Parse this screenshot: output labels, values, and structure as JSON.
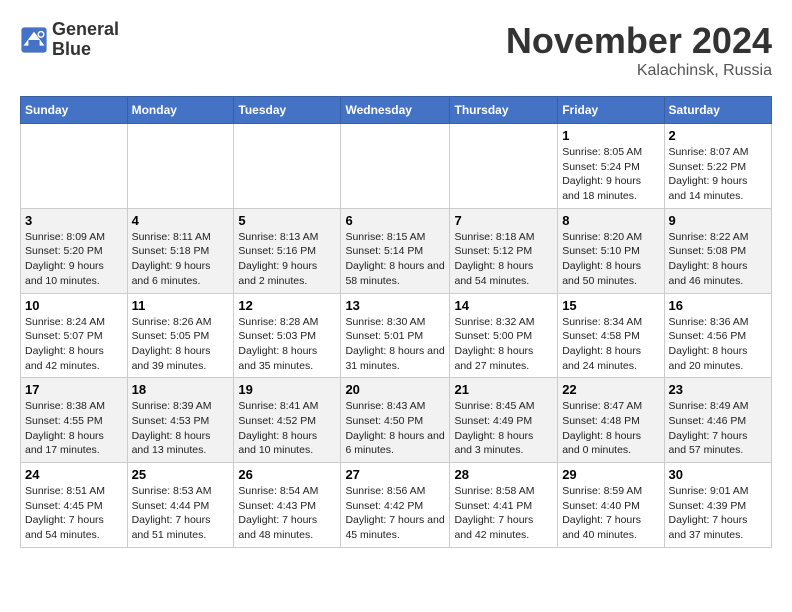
{
  "logo": {
    "line1": "General",
    "line2": "Blue"
  },
  "title": "November 2024",
  "location": "Kalachinsk, Russia",
  "days_of_week": [
    "Sunday",
    "Monday",
    "Tuesday",
    "Wednesday",
    "Thursday",
    "Friday",
    "Saturday"
  ],
  "weeks": [
    [
      {
        "day": "",
        "info": ""
      },
      {
        "day": "",
        "info": ""
      },
      {
        "day": "",
        "info": ""
      },
      {
        "day": "",
        "info": ""
      },
      {
        "day": "",
        "info": ""
      },
      {
        "day": "1",
        "info": "Sunrise: 8:05 AM\nSunset: 5:24 PM\nDaylight: 9 hours and 18 minutes."
      },
      {
        "day": "2",
        "info": "Sunrise: 8:07 AM\nSunset: 5:22 PM\nDaylight: 9 hours and 14 minutes."
      }
    ],
    [
      {
        "day": "3",
        "info": "Sunrise: 8:09 AM\nSunset: 5:20 PM\nDaylight: 9 hours and 10 minutes."
      },
      {
        "day": "4",
        "info": "Sunrise: 8:11 AM\nSunset: 5:18 PM\nDaylight: 9 hours and 6 minutes."
      },
      {
        "day": "5",
        "info": "Sunrise: 8:13 AM\nSunset: 5:16 PM\nDaylight: 9 hours and 2 minutes."
      },
      {
        "day": "6",
        "info": "Sunrise: 8:15 AM\nSunset: 5:14 PM\nDaylight: 8 hours and 58 minutes."
      },
      {
        "day": "7",
        "info": "Sunrise: 8:18 AM\nSunset: 5:12 PM\nDaylight: 8 hours and 54 minutes."
      },
      {
        "day": "8",
        "info": "Sunrise: 8:20 AM\nSunset: 5:10 PM\nDaylight: 8 hours and 50 minutes."
      },
      {
        "day": "9",
        "info": "Sunrise: 8:22 AM\nSunset: 5:08 PM\nDaylight: 8 hours and 46 minutes."
      }
    ],
    [
      {
        "day": "10",
        "info": "Sunrise: 8:24 AM\nSunset: 5:07 PM\nDaylight: 8 hours and 42 minutes."
      },
      {
        "day": "11",
        "info": "Sunrise: 8:26 AM\nSunset: 5:05 PM\nDaylight: 8 hours and 39 minutes."
      },
      {
        "day": "12",
        "info": "Sunrise: 8:28 AM\nSunset: 5:03 PM\nDaylight: 8 hours and 35 minutes."
      },
      {
        "day": "13",
        "info": "Sunrise: 8:30 AM\nSunset: 5:01 PM\nDaylight: 8 hours and 31 minutes."
      },
      {
        "day": "14",
        "info": "Sunrise: 8:32 AM\nSunset: 5:00 PM\nDaylight: 8 hours and 27 minutes."
      },
      {
        "day": "15",
        "info": "Sunrise: 8:34 AM\nSunset: 4:58 PM\nDaylight: 8 hours and 24 minutes."
      },
      {
        "day": "16",
        "info": "Sunrise: 8:36 AM\nSunset: 4:56 PM\nDaylight: 8 hours and 20 minutes."
      }
    ],
    [
      {
        "day": "17",
        "info": "Sunrise: 8:38 AM\nSunset: 4:55 PM\nDaylight: 8 hours and 17 minutes."
      },
      {
        "day": "18",
        "info": "Sunrise: 8:39 AM\nSunset: 4:53 PM\nDaylight: 8 hours and 13 minutes."
      },
      {
        "day": "19",
        "info": "Sunrise: 8:41 AM\nSunset: 4:52 PM\nDaylight: 8 hours and 10 minutes."
      },
      {
        "day": "20",
        "info": "Sunrise: 8:43 AM\nSunset: 4:50 PM\nDaylight: 8 hours and 6 minutes."
      },
      {
        "day": "21",
        "info": "Sunrise: 8:45 AM\nSunset: 4:49 PM\nDaylight: 8 hours and 3 minutes."
      },
      {
        "day": "22",
        "info": "Sunrise: 8:47 AM\nSunset: 4:48 PM\nDaylight: 8 hours and 0 minutes."
      },
      {
        "day": "23",
        "info": "Sunrise: 8:49 AM\nSunset: 4:46 PM\nDaylight: 7 hours and 57 minutes."
      }
    ],
    [
      {
        "day": "24",
        "info": "Sunrise: 8:51 AM\nSunset: 4:45 PM\nDaylight: 7 hours and 54 minutes."
      },
      {
        "day": "25",
        "info": "Sunrise: 8:53 AM\nSunset: 4:44 PM\nDaylight: 7 hours and 51 minutes."
      },
      {
        "day": "26",
        "info": "Sunrise: 8:54 AM\nSunset: 4:43 PM\nDaylight: 7 hours and 48 minutes."
      },
      {
        "day": "27",
        "info": "Sunrise: 8:56 AM\nSunset: 4:42 PM\nDaylight: 7 hours and 45 minutes."
      },
      {
        "day": "28",
        "info": "Sunrise: 8:58 AM\nSunset: 4:41 PM\nDaylight: 7 hours and 42 minutes."
      },
      {
        "day": "29",
        "info": "Sunrise: 8:59 AM\nSunset: 4:40 PM\nDaylight: 7 hours and 40 minutes."
      },
      {
        "day": "30",
        "info": "Sunrise: 9:01 AM\nSunset: 4:39 PM\nDaylight: 7 hours and 37 minutes."
      }
    ]
  ]
}
